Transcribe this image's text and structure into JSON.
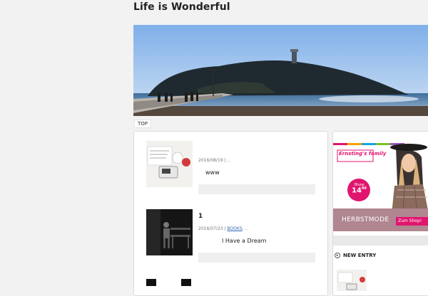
{
  "site": {
    "title": "Life is Wonderful"
  },
  "nav": {
    "top": "TOP"
  },
  "posts": [
    {
      "date_meta": "2016/08/19 | ..",
      "title": "",
      "excerpt": "www"
    },
    {
      "date_meta": "2016/07/23 | ",
      "category": "BOOKS",
      "tail": ", ..",
      "title": "1",
      "excerpt": "I Have a Dream"
    }
  ],
  "ad": {
    "brand": "Ernsting's family",
    "price_label": "Bluse",
    "price_main": "14",
    "price_cents": "99",
    "caption": "HERBSTMODE",
    "cta": "Zum Shop!"
  },
  "sidebar": {
    "new_entry": "NEW ENTRY"
  },
  "colors": {
    "ad_magenta": "#e0156e",
    "ad_panel": "#b08690",
    "sky": "#8fb8e4"
  }
}
